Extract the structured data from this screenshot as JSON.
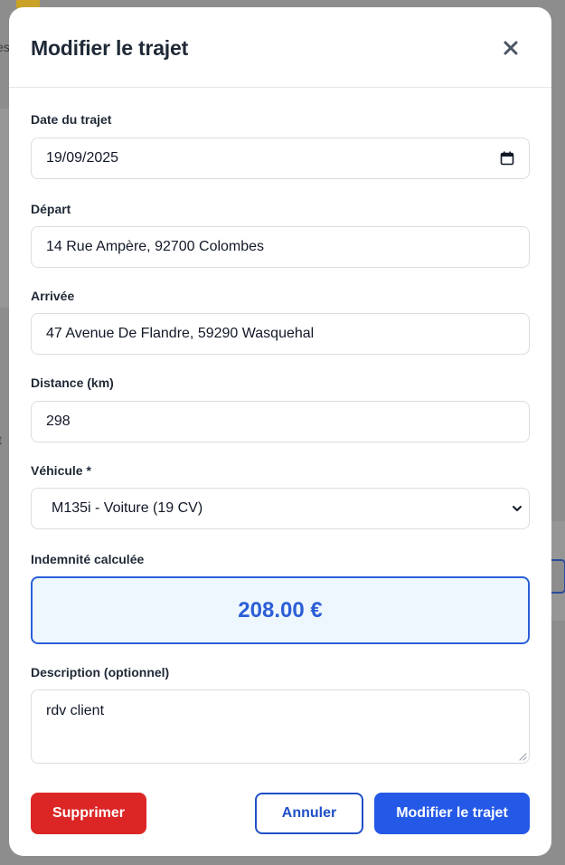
{
  "modal": {
    "title": "Modifier le trajet"
  },
  "form": {
    "date": {
      "label": "Date du trajet",
      "value": "19/09/2025"
    },
    "depart": {
      "label": "Départ",
      "value": "14 Rue Ampère, 92700 Colombes"
    },
    "arrivee": {
      "label": "Arrivée",
      "value": "47 Avenue De Flandre, 59290 Wasquehal"
    },
    "distance": {
      "label": "Distance (km)",
      "value": "298"
    },
    "vehicule": {
      "label": "Véhicule *",
      "selected": "M135i - Voiture (19 CV)"
    },
    "indemnite": {
      "label": "Indemnité calculée",
      "value": "208.00 €"
    },
    "description": {
      "label": "Description (optionnel)",
      "value": "rdv client"
    }
  },
  "buttons": {
    "delete_label": "Supprimer",
    "cancel_label": "Annuler",
    "submit_label": "Modifier le trajet"
  },
  "background": {
    "letter_e": "es",
    "letter_t": "t"
  },
  "icons": {
    "close": "close-icon",
    "calendar": "calendar-icon",
    "dropdown": "chevron-down-icon"
  },
  "colors": {
    "primary": "#2459e8",
    "danger": "#dc2626",
    "indemnity_bg": "#eef7fd",
    "indemnity_text": "#2c5ed6"
  }
}
